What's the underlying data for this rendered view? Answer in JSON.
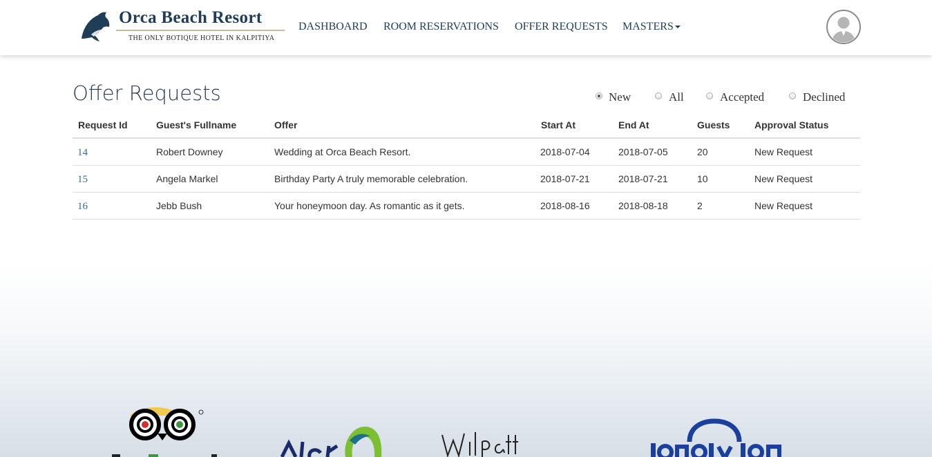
{
  "brand": {
    "name": "Orca Beach Resort",
    "tagline": "THE ONLY BOTIQUE HOTEL IN KALPITIYA"
  },
  "nav": {
    "items": [
      {
        "label": "DASHBOARD"
      },
      {
        "label": "ROOM RESERVATIONS"
      },
      {
        "label": "OFFER REQUESTS"
      },
      {
        "label": "MASTERS"
      }
    ]
  },
  "page": {
    "title": "Offer Requests"
  },
  "filters": {
    "selected": "New",
    "options": [
      {
        "label": "New",
        "checked": true
      },
      {
        "label": "All",
        "checked": false
      },
      {
        "label": "Accepted",
        "checked": false
      },
      {
        "label": "Declined",
        "checked": false
      }
    ]
  },
  "table": {
    "headers": [
      "Request Id",
      "Guest's Fullname",
      "Offer",
      "Start At",
      "End At",
      "Guests",
      "Approval Status"
    ],
    "rows": [
      {
        "id": "14",
        "name": "Robert Downey",
        "offer": "Wedding at Orca Beach Resort.",
        "start": "2018-07-04",
        "end": "2018-07-05",
        "guests": "20",
        "status": "New Request"
      },
      {
        "id": "15",
        "name": "Angela Markel",
        "offer": "Birthday Party A truly memorable celebration.",
        "start": "2018-07-21",
        "end": "2018-07-21",
        "guests": "10",
        "status": "New Request"
      },
      {
        "id": "16",
        "name": "Jebb Bush",
        "offer": "Your honeymoon day. As romantic as it gets.",
        "start": "2018-08-16",
        "end": "2018-08-18",
        "guests": "2",
        "status": "New Request"
      }
    ]
  },
  "partners": {
    "logos": [
      "tripadvisor-logo",
      "alankuda-logo",
      "wilpattu-logo",
      "lonely-planet-logo"
    ]
  },
  "colors": {
    "brand_navy": "#1f3d57",
    "link_blue": "#2f6fa7",
    "lonely_planet_blue": "#1b3f9c",
    "alankuda_green": "#7cbf32"
  }
}
